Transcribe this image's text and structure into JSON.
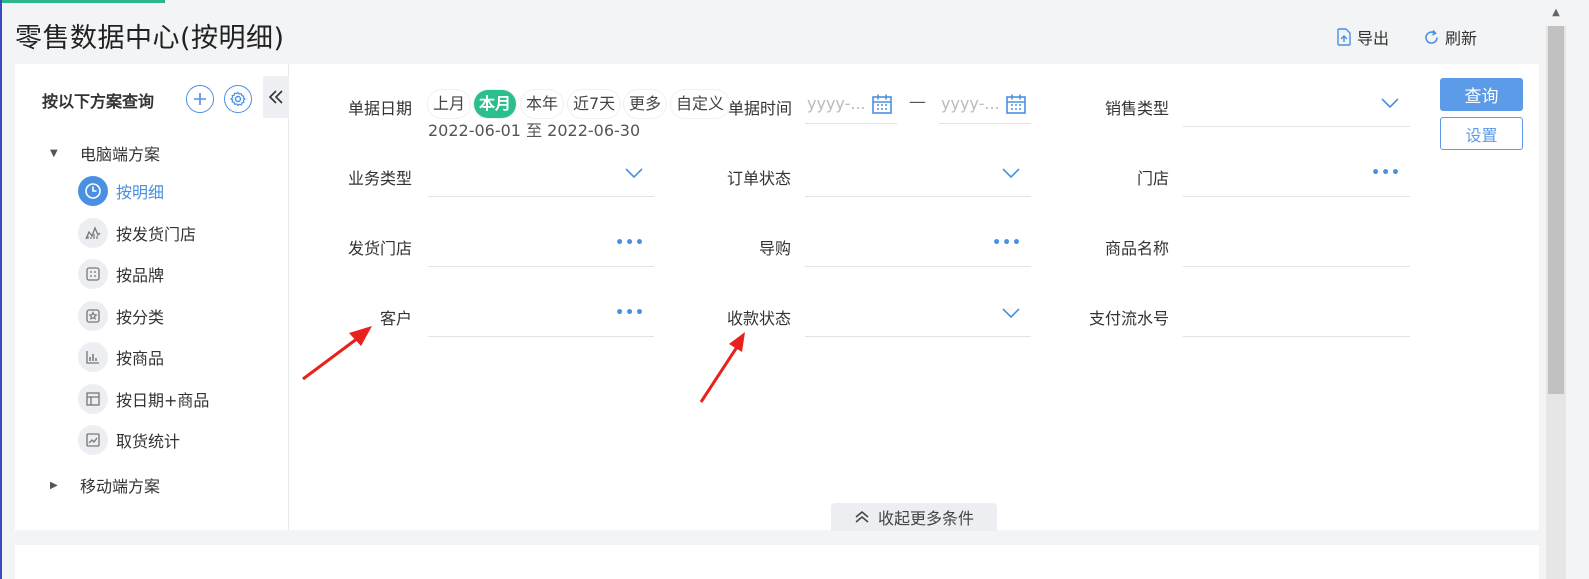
{
  "page": {
    "title": "零售数据中心(按明细)"
  },
  "header": {
    "export_label": "导出",
    "refresh_label": "刷新"
  },
  "sidebar": {
    "title": "按以下方案查询",
    "groups": [
      {
        "label": "电脑端方案",
        "expanded": true
      },
      {
        "label": "移动端方案",
        "expanded": false
      }
    ],
    "items": [
      {
        "label": "按明细",
        "icon": "clock-icon",
        "active": true
      },
      {
        "label": "按发货门店",
        "icon": "area-chart-icon"
      },
      {
        "label": "按品牌",
        "icon": "brand-card-icon"
      },
      {
        "label": "按分类",
        "icon": "star-box-icon"
      },
      {
        "label": "按商品",
        "icon": "bar-chart-icon"
      },
      {
        "label": "按日期+商品",
        "icon": "layout-icon"
      },
      {
        "label": "取货统计",
        "icon": "line-chart-icon"
      }
    ]
  },
  "filters": {
    "doc_date": {
      "label": "单据日期",
      "chips": [
        "上月",
        "本月",
        "本年",
        "近7天",
        "更多",
        "自定义"
      ],
      "selected": "本月",
      "range_text": "2022-06-01 至 2022-06-30"
    },
    "doc_time": {
      "label": "单据时间",
      "start_placeholder": "yyyy-...",
      "end_placeholder": "yyyy-...",
      "separator": "—"
    },
    "sales_type": {
      "label": "销售类型",
      "value": ""
    },
    "business_type": {
      "label": "业务类型",
      "value": ""
    },
    "order_status": {
      "label": "订单状态",
      "value": ""
    },
    "store": {
      "label": "门店",
      "value": ""
    },
    "ship_store": {
      "label": "发货门店",
      "value": ""
    },
    "guide": {
      "label": "导购",
      "value": ""
    },
    "product_name": {
      "label": "商品名称",
      "value": ""
    },
    "customer": {
      "label": "客户",
      "value": ""
    },
    "payment_status": {
      "label": "收款状态",
      "value": ""
    },
    "payment_serial": {
      "label": "支付流水号",
      "value": ""
    }
  },
  "actions": {
    "query_label": "查询",
    "settings_label": "设置",
    "collapse_label": "收起更多条件"
  },
  "colors": {
    "accent": "#4a90e2",
    "chip_on": "#2bbf8e",
    "primary_btn": "#5b9be8",
    "arrow": "#e8211c"
  }
}
